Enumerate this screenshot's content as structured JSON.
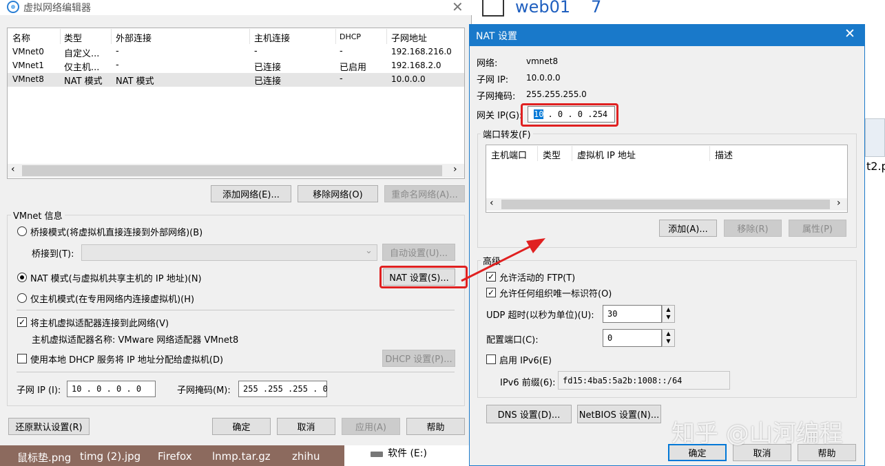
{
  "left_window": {
    "title": "虚拟网络编辑器",
    "columns": [
      "名称",
      "类型",
      "外部连接",
      "主机连接",
      "DHCP",
      "子网地址"
    ],
    "rows": [
      [
        "VMnet0",
        "自定义...",
        "-",
        "-",
        "-",
        "192.168.216.0"
      ],
      [
        "VMnet1",
        "仅主机...",
        "-",
        "已连接",
        "已启用",
        "192.168.2.0"
      ],
      [
        "VMnet8",
        "NAT 模式",
        "NAT 模式",
        "已连接",
        "-",
        "10.0.0.0"
      ]
    ],
    "buttons": {
      "add_network": "添加网络(E)...",
      "remove_network": "移除网络(O)",
      "rename_network": "重命名网络(A)..."
    },
    "vmnet_info": "VMnet 信息",
    "bridge_mode": "桥接模式(将虚拟机直接连接到外部网络)(B)",
    "bridge_to": "桥接到(T):",
    "auto_settings": "自动设置(U)...",
    "nat_mode": "NAT 模式(与虚拟机共享主机的 IP 地址)(N)",
    "nat_settings": "NAT 设置(S)...",
    "host_only": "仅主机模式(在专用网络内连接虚拟机)(H)",
    "connect_adapter": "将主机虚拟适配器连接到此网络(V)",
    "adapter_name": "主机虚拟适配器名称: VMware 网络适配器 VMnet8",
    "use_dhcp": "使用本地 DHCP 服务将 IP 地址分配给虚拟机(D)",
    "dhcp_settings": "DHCP 设置(P)...",
    "subnet_ip_label": "子网 IP (I):",
    "subnet_ip": "10 . 0 . 0 . 0",
    "subnet_mask_label": "子网掩码(M):",
    "subnet_mask": "255 .255 .255 . 0",
    "restore": "还原默认设置(R)",
    "ok": "确定",
    "cancel": "取消",
    "apply": "应用(A)",
    "help": "帮助"
  },
  "nat_dialog": {
    "title": "NAT 设置",
    "network_label": "网络:",
    "network": "vmnet8",
    "subnet_ip_label": "子网 IP:",
    "subnet_ip": "10.0.0.0",
    "subnet_mask_label": "子网掩码:",
    "subnet_mask": "255.255.255.0",
    "gateway_label": "网关 IP(G):",
    "gateway_sel": "10",
    "gateway_rest": ". 0 . 0 .254",
    "port_forward": "端口转发(F)",
    "pf_columns": [
      "主机端口",
      "类型",
      "虚拟机 IP 地址",
      "描述"
    ],
    "add": "添加(A)...",
    "remove": "移除(R)",
    "properties": "属性(P)",
    "advanced": "高级",
    "allow_ftp": "允许活动的 FTP(T)",
    "allow_oui": "允许任何组织唯一标识符(O)",
    "udp_label": "UDP 超时(以秒为单位)(U):",
    "udp_value": "30",
    "config_port_label": "配置端口(C):",
    "config_port_value": "0",
    "enable_ipv6": "启用 IPv6(E)",
    "ipv6_prefix_label": "IPv6 前缀(6):",
    "ipv6_prefix": "fd15:4ba5:5a2b:1008::/64",
    "dns": "DNS 设置(D)...",
    "netbios": "NetBIOS 设置(N)...",
    "ok": "确定",
    "cancel": "取消",
    "help": "帮助"
  },
  "background": {
    "title_text": "web01",
    "title_num": "7",
    "side_text": "t2.p",
    "taskbar": [
      "鼠标垫.png",
      "timg (2).jpg",
      "Firefox",
      "lnmp.tar.gz",
      "zhihu"
    ],
    "drive": "软件 (E:)",
    "watermark": "知乎 @山河编程"
  }
}
